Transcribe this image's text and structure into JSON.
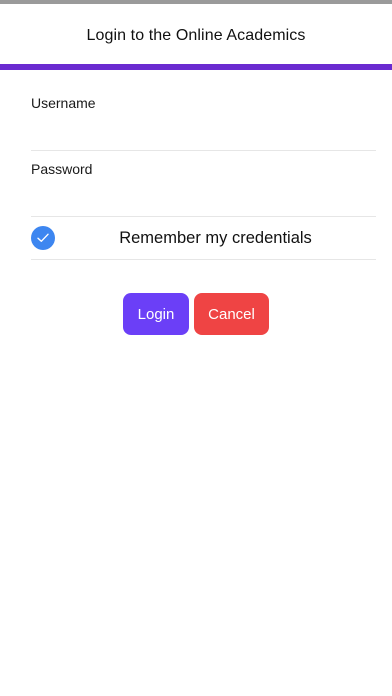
{
  "header": {
    "title": "Login to the Online Academics"
  },
  "form": {
    "username": {
      "label": "Username",
      "value": "",
      "placeholder": ""
    },
    "password": {
      "label": "Password",
      "value": "",
      "placeholder": ""
    },
    "remember": {
      "label": "Remember my credentials",
      "checked": true
    }
  },
  "actions": {
    "login_label": "Login",
    "cancel_label": "Cancel"
  },
  "colors": {
    "accent": "#6a2ad0",
    "login_button": "#6b3ff7",
    "cancel_button": "#ef4444",
    "checkbox": "#3d86f0"
  },
  "icons": {
    "checkbox": "checkmark-icon"
  }
}
